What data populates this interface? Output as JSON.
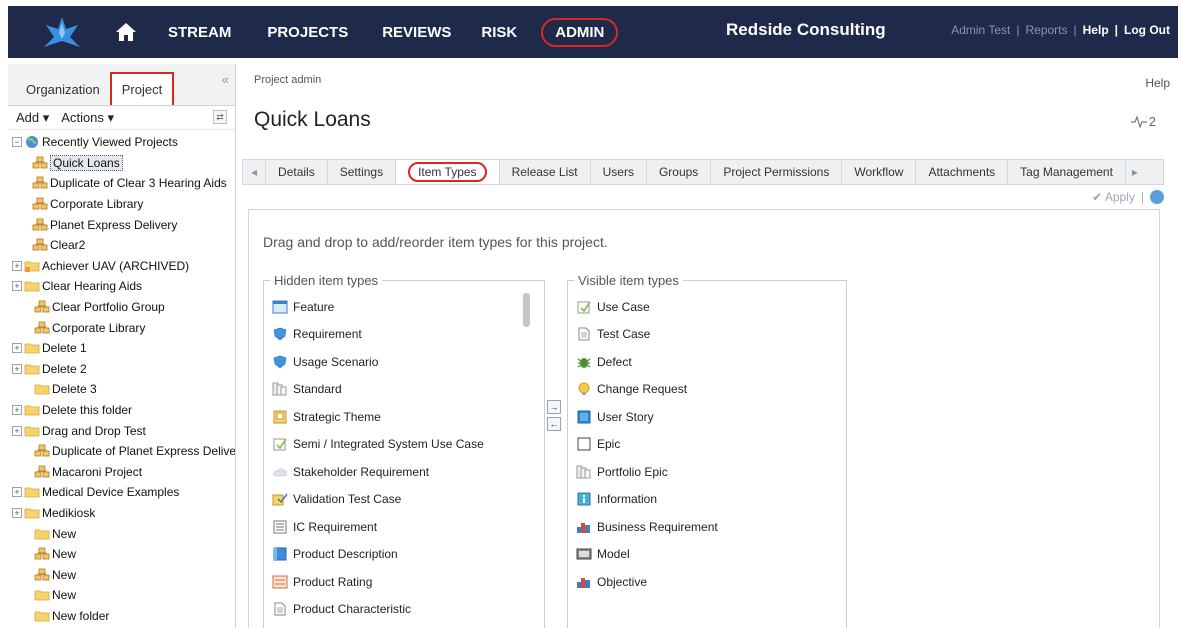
{
  "topnav": {
    "home_icon": "home-icon",
    "items": [
      "STREAM",
      "PROJECTS",
      "REVIEWS",
      "RISK"
    ],
    "admin": "ADMIN",
    "company": "Redside Consulting",
    "user": "Admin Test",
    "sep1": "|",
    "reports": "Reports",
    "sep2": "|",
    "help": "Help",
    "sep3": "|",
    "logout": "Log Out"
  },
  "leftpanel": {
    "tabs": [
      "Organization",
      "Project"
    ],
    "collapse": "«",
    "add": "Add ▾",
    "actions": "Actions ▾",
    "refresh": "⇄",
    "tree": [
      {
        "label": "Recently Viewed Projects",
        "icon": "globe",
        "exp": "−",
        "indent": 0
      },
      {
        "label": "Quick Loans",
        "icon": "project",
        "indent": 2,
        "selected": true
      },
      {
        "label": "Duplicate of Clear 3 Hearing Aids",
        "icon": "project",
        "indent": 2
      },
      {
        "label": "Corporate Library",
        "icon": "project",
        "indent": 2
      },
      {
        "label": "Planet Express Delivery",
        "icon": "project",
        "indent": 2
      },
      {
        "label": "Clear2",
        "icon": "project",
        "indent": 2
      },
      {
        "label": "Achiever UAV (ARCHIVED)",
        "icon": "folder-lock",
        "exp": "+",
        "indent": 0
      },
      {
        "label": "Clear Hearing Aids",
        "icon": "folder",
        "exp": "+",
        "indent": 0
      },
      {
        "label": "Clear Portfolio Group",
        "icon": "project",
        "indent": 1
      },
      {
        "label": "Corporate Library",
        "icon": "project",
        "indent": 1
      },
      {
        "label": "Delete 1",
        "icon": "folder",
        "exp": "+",
        "indent": 0
      },
      {
        "label": "Delete 2",
        "icon": "folder",
        "exp": "+",
        "indent": 0
      },
      {
        "label": "Delete 3",
        "icon": "folder",
        "indent": 1
      },
      {
        "label": "Delete this folder",
        "icon": "folder",
        "exp": "+",
        "indent": 0
      },
      {
        "label": "Drag and Drop Test",
        "icon": "folder",
        "exp": "+",
        "indent": 0
      },
      {
        "label": "Duplicate of Planet Express Delivery",
        "icon": "project",
        "indent": 1
      },
      {
        "label": "Macaroni Project",
        "icon": "project",
        "indent": 1
      },
      {
        "label": "Medical Device Examples",
        "icon": "folder",
        "exp": "+",
        "indent": 0
      },
      {
        "label": "Medikiosk",
        "icon": "folder",
        "exp": "+",
        "indent": 0
      },
      {
        "label": "New",
        "icon": "folder",
        "indent": 1
      },
      {
        "label": "New",
        "icon": "project",
        "indent": 1
      },
      {
        "label": "New",
        "icon": "project",
        "indent": 1
      },
      {
        "label": "New",
        "icon": "folder",
        "indent": 1
      },
      {
        "label": "New folder",
        "icon": "folder",
        "indent": 1
      }
    ]
  },
  "main": {
    "breadcrumb": "Project admin",
    "help": "Help",
    "title": "Quick Loans",
    "activity_icon": "activity-icon",
    "activity_count": "2",
    "tabs": [
      "Details",
      "Settings",
      "Item Types",
      "Release List",
      "Users",
      "Groups",
      "Project Permissions",
      "Workflow",
      "Attachments",
      "Tag Management"
    ],
    "active_tab": "Item Types",
    "apply": "Apply",
    "instructions": "Drag and drop to add/reorder item types for this project.",
    "hidden_legend": "Hidden item types",
    "visible_legend": "Visible item types",
    "hidden_items": [
      {
        "label": "Feature",
        "icon": "feature"
      },
      {
        "label": "Requirement",
        "icon": "requirement"
      },
      {
        "label": "Usage Scenario",
        "icon": "requirement"
      },
      {
        "label": "Standard",
        "icon": "standard"
      },
      {
        "label": "Strategic Theme",
        "icon": "theme"
      },
      {
        "label": "Semi / Integrated System Use Case",
        "icon": "usecase"
      },
      {
        "label": "Stakeholder Requirement",
        "icon": "cloud"
      },
      {
        "label": "Validation Test Case",
        "icon": "validation"
      },
      {
        "label": "IC Requirement",
        "icon": "ic"
      },
      {
        "label": "Product Description",
        "icon": "productdesc"
      },
      {
        "label": "Product Rating",
        "icon": "rating"
      },
      {
        "label": "Product Characteristic",
        "icon": "doc"
      }
    ],
    "visible_items": [
      {
        "label": "Use Case",
        "icon": "usecase"
      },
      {
        "label": "Test Case",
        "icon": "doc"
      },
      {
        "label": "Defect",
        "icon": "defect"
      },
      {
        "label": "Change Request",
        "icon": "change"
      },
      {
        "label": "User Story",
        "icon": "story"
      },
      {
        "label": "Epic",
        "icon": "epic"
      },
      {
        "label": "Portfolio Epic",
        "icon": "standard"
      },
      {
        "label": "Information",
        "icon": "info"
      },
      {
        "label": "Business Requirement",
        "icon": "business"
      },
      {
        "label": "Model",
        "icon": "model"
      },
      {
        "label": "Objective",
        "icon": "business"
      }
    ],
    "move_right": "→",
    "move_left": "←"
  }
}
